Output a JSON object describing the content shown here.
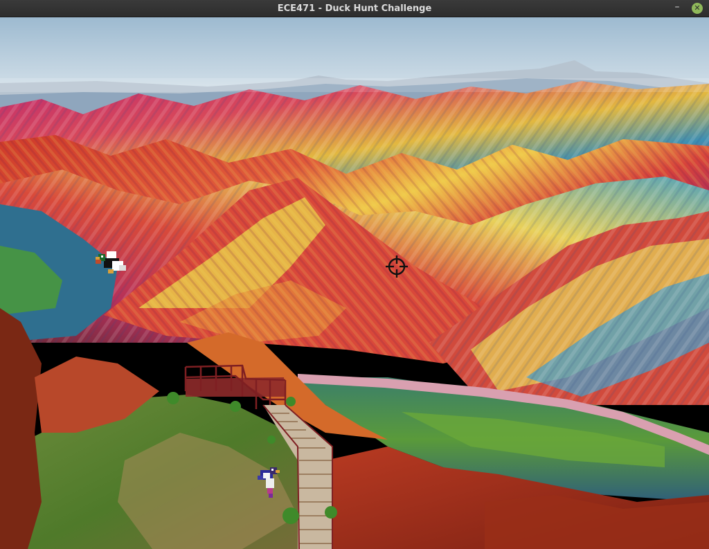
{
  "window": {
    "title": "ECE471 - Duck Hunt Challenge",
    "controls": {
      "minimize_glyph": "–",
      "close_glyph": "✕"
    }
  },
  "scene": {
    "background": "rainbow-mountains-landscape",
    "palette": {
      "sky_top": "#a9c6db",
      "sky_bottom": "#e7eef2",
      "red": "#c8322a",
      "magenta": "#a8226a",
      "yellow": "#e8c73a",
      "teal": "#3f8fb0",
      "green": "#4f8a2f",
      "walkway": "#8e2a2a"
    }
  },
  "sprites": [
    {
      "name": "duck",
      "kind": "flying-duck",
      "icon": "duck-icon"
    },
    {
      "name": "duck",
      "kind": "flying-duck",
      "icon": "duck-icon"
    }
  ],
  "crosshair": {
    "icon": "crosshair-icon",
    "color": "#111111"
  }
}
